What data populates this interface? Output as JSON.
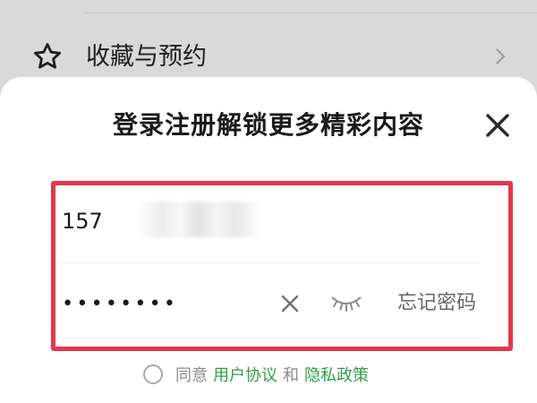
{
  "background_menu": {
    "item": {
      "label": "收藏与预约",
      "icon": "star-icon"
    },
    "chevron_icon": "chevron-right-icon"
  },
  "login_sheet": {
    "title": "登录注册解锁更多精彩内容",
    "close_icon": "close-icon",
    "phone": {
      "value": "157",
      "obscured": true
    },
    "password": {
      "masked_value": "••••••••",
      "clear_icon": "clear-icon",
      "visibility_icon": "eye-closed-icon"
    },
    "forgot_password_label": "忘记密码",
    "agreement": {
      "prefix": "同意",
      "user_agreement": "用户协议",
      "conjunction": "和",
      "privacy_policy": "隐私政策"
    }
  },
  "colors": {
    "highlight_border": "#e3374a",
    "link_green": "#2e9e47",
    "backdrop": "#d9d9d9"
  }
}
